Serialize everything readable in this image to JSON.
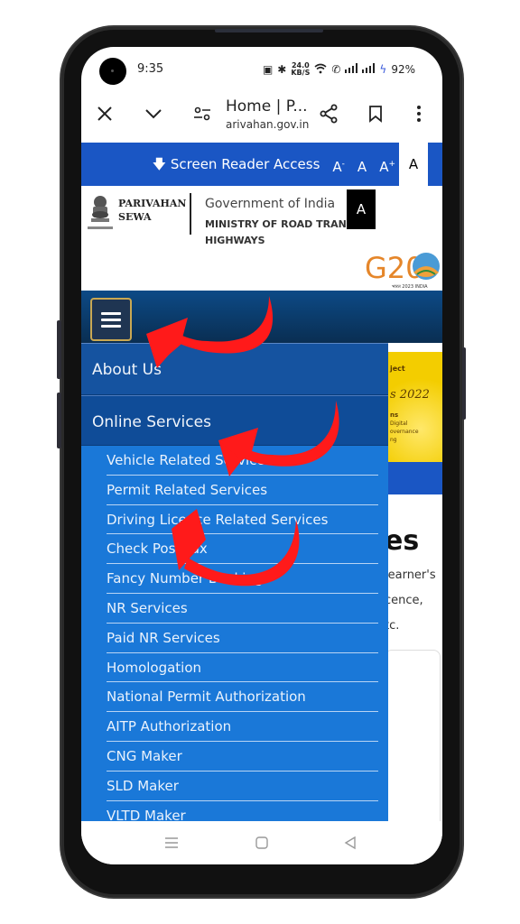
{
  "status_bar": {
    "time": "9:35",
    "net_speed_value": "24.0",
    "net_speed_unit": "KB/S",
    "battery": "92%",
    "icons": [
      "nfc-icon",
      "bluetooth-icon",
      "wifi-icon",
      "volte-call-icon",
      "signal-icon",
      "signal-icon",
      "charging-bolt-icon"
    ]
  },
  "browser": {
    "page_title": "Home | P...",
    "url": "arivahan.gov.in",
    "buttons": {
      "close": "close-icon",
      "collapse": "chevron-down-icon",
      "site_settings": "tune-icon",
      "share": "share-icon",
      "bookmark": "bookmark-icon",
      "more": "more-vert-icon"
    }
  },
  "accessibility_bar": {
    "screen_reader": "Screen Reader Access",
    "font_decrease": "A",
    "font_decrease_sup": "-",
    "font_normal": "A",
    "font_increase": "A",
    "font_increase_sup": "+",
    "contrast": "A"
  },
  "header": {
    "brand_line1": "PARIVAHAN",
    "brand_line2": "SEWA",
    "gov": "Government of India",
    "ministry_line1": "MINISTRY OF ROAD TRANSPORT &",
    "ministry_line2": "HIGHWAYS",
    "contrast_box": "A",
    "g20_text": "G20",
    "g20_sub": "भारत 2023 INDIA"
  },
  "menu": {
    "top_items": [
      "About Us",
      "Online Services"
    ],
    "online_services": [
      "Vehicle Related Services",
      "Permit Related Services",
      "Driving Licence Related Services",
      "Check Post Tax",
      "Fancy Number Booking",
      "NR Services",
      "Paid NR Services",
      "Homologation",
      "National Permit Authorization",
      "AITP Authorization",
      "CNG Maker",
      "SLD Maker",
      "VLTD Maker"
    ]
  },
  "background": {
    "banner_line1": "ject",
    "banner_line2": "s 2022",
    "banner_line3": "ns",
    "banner_small": [
      "Digital",
      "overnance",
      "ng"
    ],
    "section_title": "es",
    "text_lines": [
      "learner's",
      "cence,",
      "tc."
    ]
  },
  "colors": {
    "accent_blue": "#1a56c4",
    "menu_blue": "#1a78d8",
    "annotation_red": "#ff1a1a"
  }
}
